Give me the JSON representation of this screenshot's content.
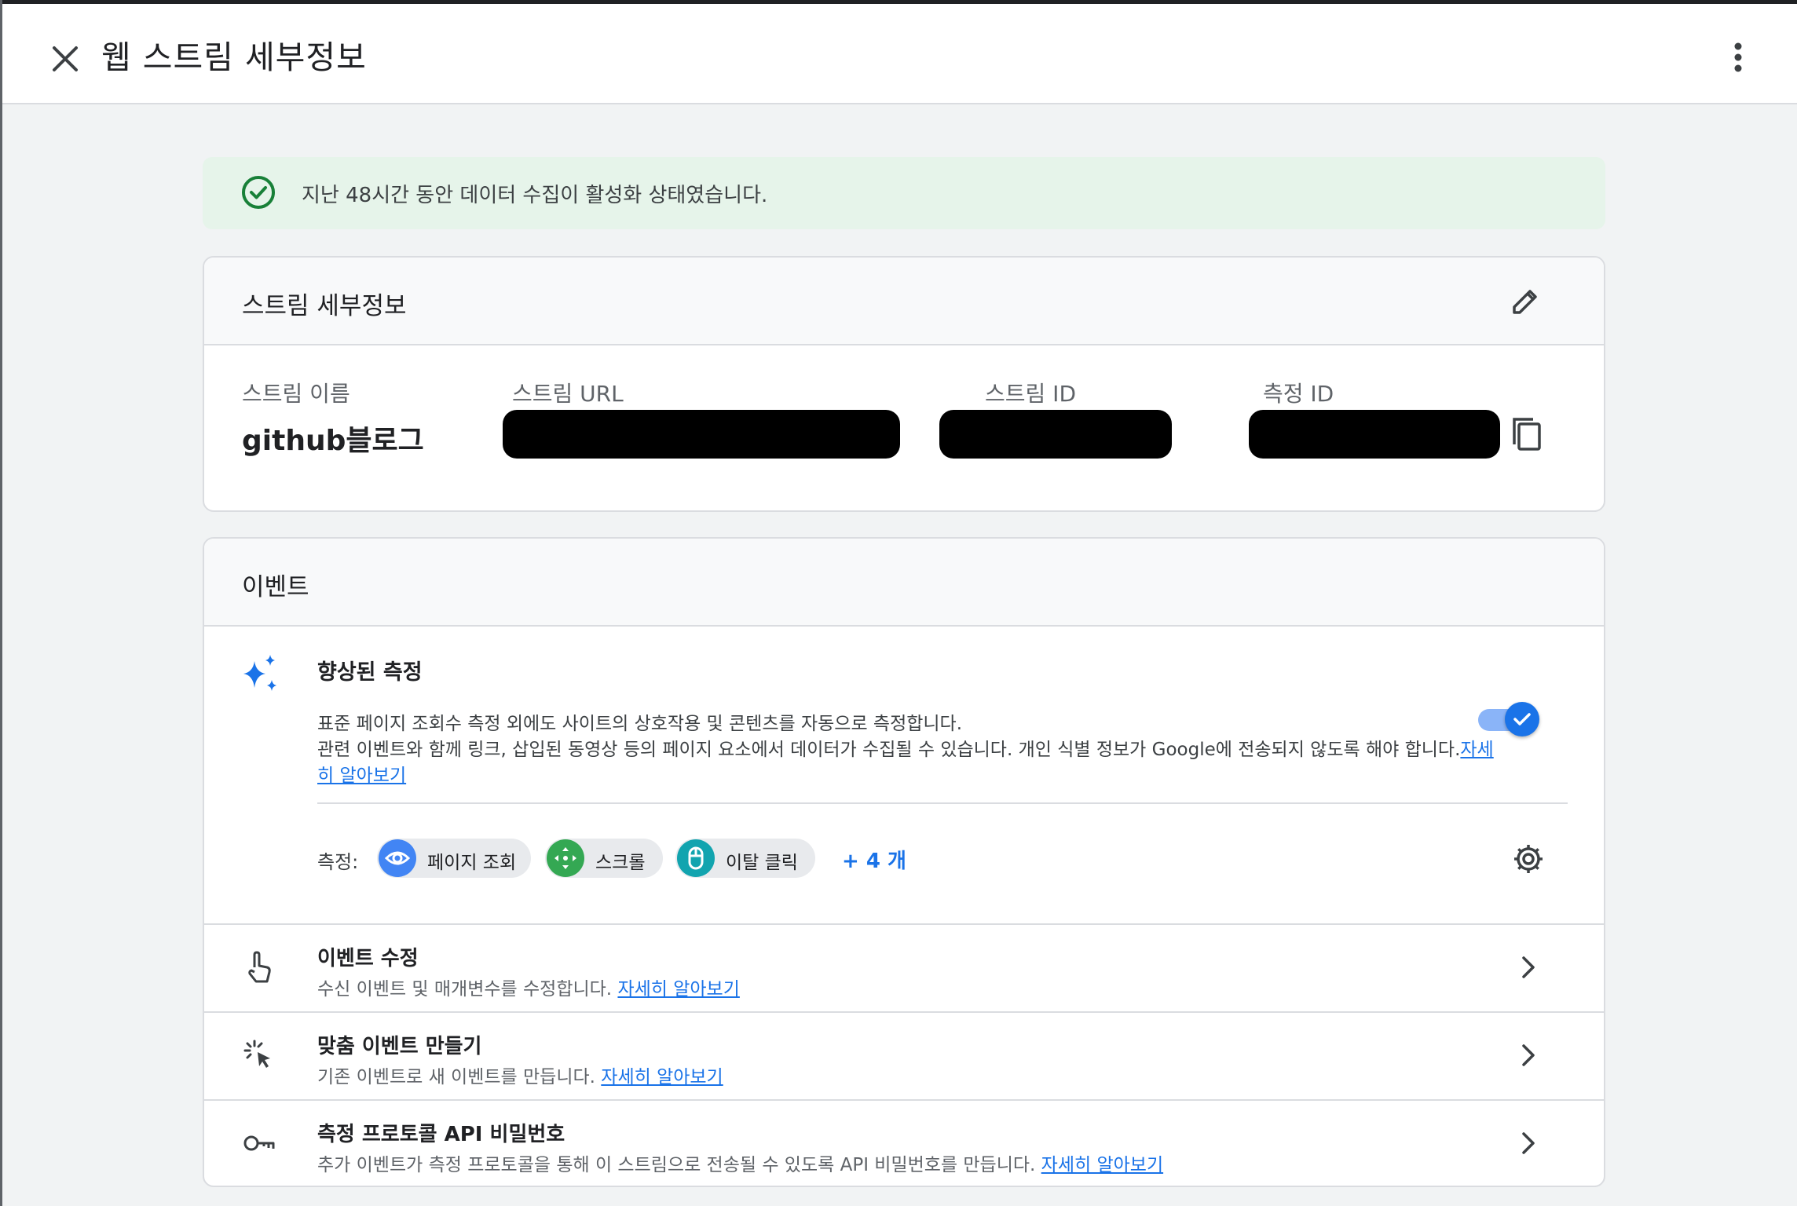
{
  "header": {
    "title": "웹 스트림 세부정보",
    "close_icon": "close-icon",
    "more_icon": "more-vert-icon"
  },
  "banner": {
    "text": "지난 48시간 동안 데이터 수집이 활성화 상태였습니다.",
    "icon": "check-circle-icon",
    "color": "#e6f4ea"
  },
  "stream_details": {
    "title": "스트림 세부정보",
    "name_label": "스트림 이름",
    "name_value": "github블로그",
    "url_label": "스트림 URL",
    "id_label": "스트림 ID",
    "measurement_label": "측정 ID"
  },
  "events": {
    "title": "이벤트",
    "enhanced": {
      "title": "향상된 측정",
      "desc_line1": "표준 페이지 조회수 측정 외에도 사이트의 상호작용 및 콘텐츠를 자동으로 측정합니다.",
      "desc_line2": "관련 이벤트와 함께 링크, 삽입된 동영상 등의 페이지 요소에서 데이터가 수집될 수 있습니다. 개인 식별 정보가 Google에 전송되지 않도록 해야 합니다.",
      "learn_more": "자세히 알아보기",
      "toggle_on": true
    },
    "measure_label": "측정:",
    "chips": [
      {
        "label": "페이지 조회",
        "icon": "eye-icon",
        "color": "#4285f4"
      },
      {
        "label": "스크롤",
        "icon": "scroll-arrows-icon",
        "color": "#34a853"
      },
      {
        "label": "이탈 클릭",
        "icon": "mouse-icon",
        "color": "#12a4af"
      }
    ],
    "more_chips": "+ 4 개",
    "rows": [
      {
        "title": "이벤트 수정",
        "subtitle": "수신 이벤트 및 매개변수를 수정합니다.",
        "link": "자세히 알아보기",
        "icon": "touch-icon"
      },
      {
        "title": "맞춤 이벤트 만들기",
        "subtitle": "기존 이벤트로 새 이벤트를 만듭니다.",
        "link": "자세히 알아보기",
        "icon": "cursor-click-icon"
      },
      {
        "title": "측정 프로토콜 API 비밀번호",
        "subtitle": "추가 이벤트가 측정 프로토콜을 통해 이 스트림으로 전송될 수 있도록 API 비밀번호를 만듭니다.",
        "link": "자세히 알아보기",
        "icon": "key-icon"
      }
    ]
  },
  "colors": {
    "accent": "#1a73e8",
    "success": "#188038"
  }
}
